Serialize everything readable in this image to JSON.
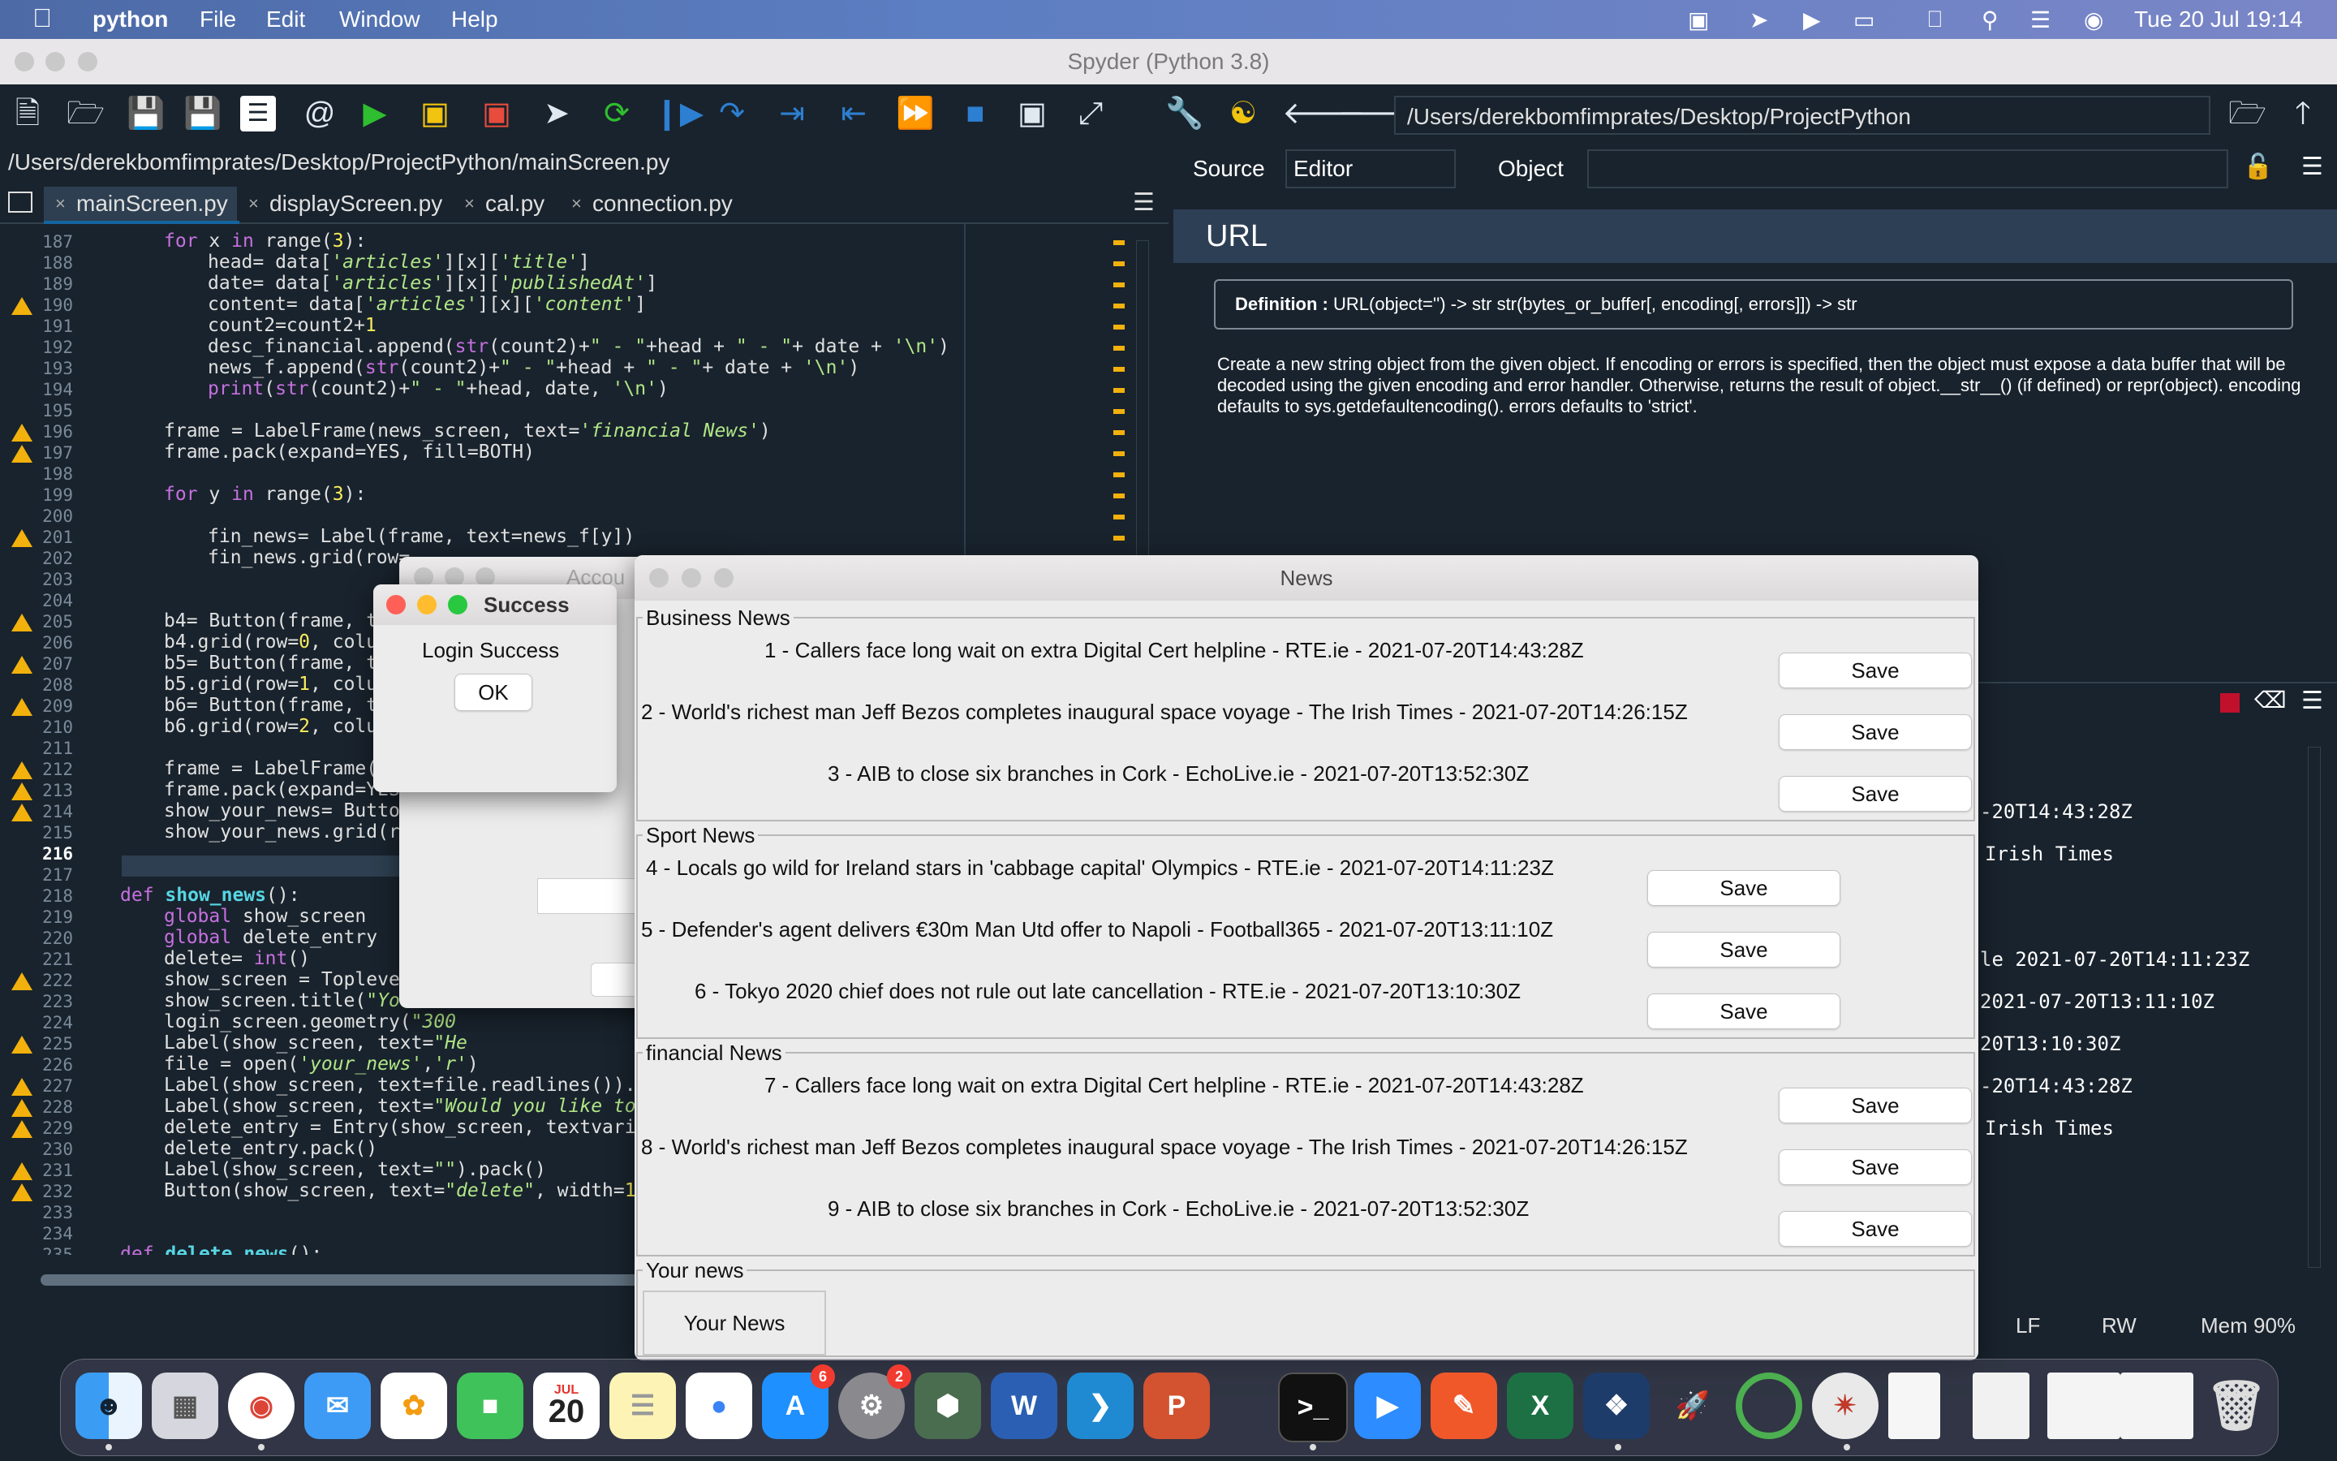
{
  "menubar": {
    "app": "python",
    "items": [
      "File",
      "Edit",
      "Window",
      "Help"
    ],
    "clock": "Tue 20 Jul  19:14"
  },
  "spyder": {
    "title": "Spyder (Python 3.8)",
    "working_dir": "/Users/derekbomfimprates/Desktop/ProjectPython",
    "file_path": "/Users/derekbomfimprates/Desktop/ProjectPython/mainScreen.py",
    "tabs": [
      "mainScreen.py",
      "displayScreen.py",
      "cal.py",
      "connection.py"
    ],
    "help": {
      "source_label": "Source",
      "source_value": "Editor",
      "object_label": "Object",
      "heading": "URL",
      "definition_label": "Definition :",
      "definition": "URL(object='') -> str str(bytes_or_buffer[, encoding[, errors]]) -> str",
      "description": "Create a new string object from the given object. If encoding or errors is specified, then the object must expose a data buffer that will be decoded using the given encoding and error handler. Otherwise, returns the result of object.__str__() (if defined) or repr(object). encoding defaults to sys.getdefaultencoding(). errors defaults to 'strict'."
    },
    "console_fragments": [
      "-20T14:43:28Z",
      "Irish Times",
      "le 2021-07-20T14:11:23Z",
      "2021-07-20T13:11:10Z",
      "20T13:10:30Z",
      "-20T14:43:28Z",
      "Irish Times"
    ],
    "status": {
      "eol": "LF",
      "perm": "RW",
      "mem": "Mem 90%"
    }
  },
  "success_dialog": {
    "title": "Success",
    "message": "Login Success",
    "ok": "OK"
  },
  "account_window": {
    "title": "Accou"
  },
  "news_window": {
    "title": "News",
    "save_label": "Save",
    "sections": [
      {
        "title": "Business News",
        "items": [
          "1 - Callers face long wait on extra Digital Cert helpline - RTE.ie - 2021-07-20T14:43:28Z",
          "2 - World's richest man Jeff Bezos completes inaugural space voyage - The Irish Times - 2021-07-20T14:26:15Z",
          "3 - AIB to close six branches in Cork - EchoLive.ie - 2021-07-20T13:52:30Z"
        ]
      },
      {
        "title": "Sport News",
        "items": [
          "4 - Locals go wild for Ireland stars in 'cabbage capital' Olympics - RTE.ie - 2021-07-20T14:11:23Z",
          "5 - Defender's agent delivers €30m Man Utd offer to Napoli - Football365 - 2021-07-20T13:11:10Z",
          "6 - Tokyo 2020 chief does not rule out late cancellation - RTE.ie - 2021-07-20T13:10:30Z"
        ]
      },
      {
        "title": "financial News",
        "items": [
          "7 - Callers face long wait on extra Digital Cert helpline - RTE.ie - 2021-07-20T14:43:28Z",
          "8 - World's richest man Jeff Bezos completes inaugural space voyage - The Irish Times - 2021-07-20T14:26:15Z",
          "9 - AIB to close six branches in Cork - EchoLive.ie - 2021-07-20T13:52:30Z"
        ]
      }
    ],
    "your_news_title": "Your news",
    "your_news_button": "Your News"
  },
  "dock": {
    "calendar_month": "JUL",
    "calendar_day": "20",
    "appstore_badge": "6",
    "settings_badge": "2"
  }
}
